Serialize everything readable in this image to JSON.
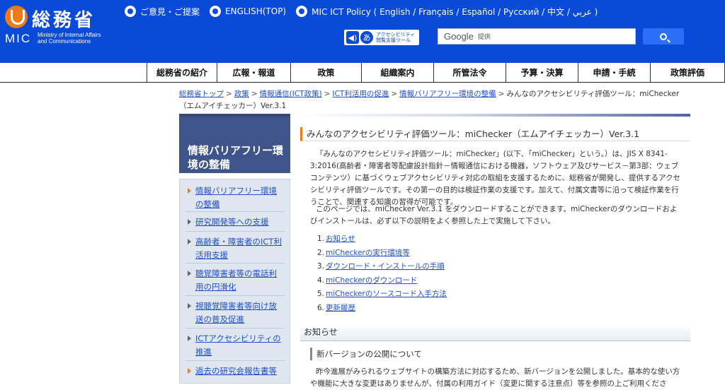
{
  "header": {
    "logo_kanji": "総務省",
    "logo_mic": "MIC",
    "logo_sub": "Ministry of Internal Affairs\nand Communications",
    "top_links": [
      "ご意見・ご提案",
      "ENGLISH(TOP)",
      "MIC ICT Policy ( English / Français / Español / Русский / 中文 / عربي )"
    ],
    "a11y_tool_label": "アクセシビリティ\n閲覧支援ツール",
    "search": {
      "brand": "Google",
      "provided": "提供",
      "button_icon": "search-icon"
    }
  },
  "gnav": [
    "総務省の紹介",
    "広報・報道",
    "政策",
    "組織案内",
    "所管法令",
    "予算・決算",
    "申請・手続",
    "政策評価"
  ],
  "breadcrumb": {
    "links": [
      "総務省トップ",
      "政策",
      "情報通信(ICT政策)",
      "ICT利活用の促進",
      "情報バリアフリー環境の整備"
    ],
    "current": "みんなのアクセシビリティ評価ツール：miChecker（エムアイチェッカー）Ver.3.1",
    "separator": ">"
  },
  "sidebar": {
    "heading": "情報バリアフリー環境の整備",
    "items": [
      "情報バリアフリー環境の整備",
      "研究開発等への支援",
      "高齢者・障害者のICT利活用支援",
      "聴覚障害者等の電話利用の円滑化",
      "視聴覚障害者等向け放送の普及促進",
      "ICTアクセシビリティの推進",
      "過去の研究会報告書等"
    ]
  },
  "main": {
    "title": "みんなのアクセシビリティ評価ツール：miChecker（エムアイチェッカー）Ver.3.1",
    "intro": "「みんなのアクセシビリティ評価ツール：miChecker」(以下、「miChecker」という。）は、JIS X 8341-3:2016(高齢者・障害者等配慮設計指針－情報通信における機器，ソフトウェア及びサービス－第3部：ウェブコンテンツ）に基づくウェブアクセシビリティ対応の取組を支援するために、総務省が開発し、提供するアクセシビリティ評価ツールです。その第一の目的は検証作業の支援です。加えて、付属文書等に沿って検証作業を行うことで、関連する知識の習得が可能です。",
    "download_note": "このページでは、miChecker Ver.3.1 をダウンロードすることができます。miCheckerのダウンロードおよびインストールは、必ず以下の説明をよく参照した上で実施して下さい。",
    "toc": [
      {
        "num": "1.",
        "label": "お知らせ"
      },
      {
        "num": "2.",
        "label": "miCheckerの実行環境等"
      },
      {
        "num": "3.",
        "label": "ダウンロード・インストールの手順"
      },
      {
        "num": "4.",
        "label": "miCheckerのダウンロード"
      },
      {
        "num": "5.",
        "label": "miCheckerのソースコード入手方法"
      },
      {
        "num": "6.",
        "label": "更新履歴"
      }
    ],
    "notice_heading": "お知らせ",
    "notice_sub": "新バージョンの公開について",
    "notice_body": "昨今進展がみられるウェブサイトの構築方法に対応するため、新バージョンを公開しました。基本的な使い方や機能に大きな変更はありませんが、付属の利用ガイド（変更に関する注意点）等を参照の上ご利用ください。"
  },
  "colors": {
    "header_bg": "#0a4ad8",
    "accent": "#f07a1a",
    "link": "#2250c8",
    "sidebar_head": "#40548c",
    "sidebar_bg": "#dfe6ef"
  }
}
